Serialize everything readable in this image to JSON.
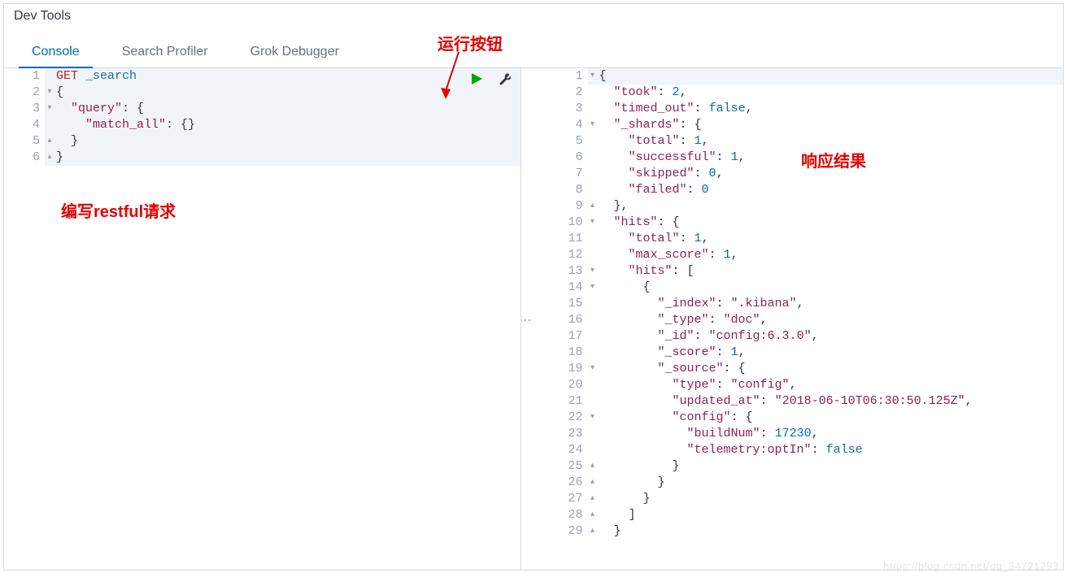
{
  "title": "Dev Tools",
  "tabs": [
    "Console",
    "Search Profiler",
    "Grok Debugger"
  ],
  "annotations": {
    "run_button": "运行按钮",
    "request": "编写restful请求",
    "response": "响应结果"
  },
  "request_editor": {
    "method": "GET",
    "endpoint": "_search",
    "lines": [
      {
        "n": 1,
        "fold": "",
        "tokens": [
          {
            "t": "method",
            "v": "GET"
          },
          {
            "t": "plain",
            "v": " "
          },
          {
            "t": "endpoint",
            "v": "_search"
          }
        ]
      },
      {
        "n": 2,
        "fold": "▾",
        "tokens": [
          {
            "t": "punct",
            "v": "{"
          }
        ]
      },
      {
        "n": 3,
        "fold": "▾",
        "tokens": [
          {
            "t": "plain",
            "v": "  "
          },
          {
            "t": "key",
            "v": "\"query\""
          },
          {
            "t": "punct",
            "v": ": {"
          }
        ]
      },
      {
        "n": 4,
        "fold": "",
        "tokens": [
          {
            "t": "plain",
            "v": "    "
          },
          {
            "t": "key",
            "v": "\"match_all\""
          },
          {
            "t": "punct",
            "v": ": {}"
          }
        ]
      },
      {
        "n": 5,
        "fold": "▴",
        "tokens": [
          {
            "t": "plain",
            "v": "  "
          },
          {
            "t": "punct",
            "v": "}"
          }
        ]
      },
      {
        "n": 6,
        "fold": "▴",
        "tokens": [
          {
            "t": "punct",
            "v": "}"
          }
        ]
      }
    ]
  },
  "response_editor": {
    "lines": [
      {
        "n": 1,
        "fold": "▾",
        "hl": true,
        "tokens": [
          {
            "t": "punct",
            "v": "{"
          }
        ]
      },
      {
        "n": 2,
        "fold": "",
        "tokens": [
          {
            "t": "plain",
            "v": "  "
          },
          {
            "t": "key",
            "v": "\"took\""
          },
          {
            "t": "punct",
            "v": ": "
          },
          {
            "t": "num",
            "v": "2"
          },
          {
            "t": "punct",
            "v": ","
          }
        ]
      },
      {
        "n": 3,
        "fold": "",
        "tokens": [
          {
            "t": "plain",
            "v": "  "
          },
          {
            "t": "key",
            "v": "\"timed_out\""
          },
          {
            "t": "punct",
            "v": ": "
          },
          {
            "t": "kw",
            "v": "false"
          },
          {
            "t": "punct",
            "v": ","
          }
        ]
      },
      {
        "n": 4,
        "fold": "▾",
        "tokens": [
          {
            "t": "plain",
            "v": "  "
          },
          {
            "t": "key",
            "v": "\"_shards\""
          },
          {
            "t": "punct",
            "v": ": {"
          }
        ]
      },
      {
        "n": 5,
        "fold": "",
        "tokens": [
          {
            "t": "plain",
            "v": "    "
          },
          {
            "t": "key",
            "v": "\"total\""
          },
          {
            "t": "punct",
            "v": ": "
          },
          {
            "t": "num",
            "v": "1"
          },
          {
            "t": "punct",
            "v": ","
          }
        ]
      },
      {
        "n": 6,
        "fold": "",
        "tokens": [
          {
            "t": "plain",
            "v": "    "
          },
          {
            "t": "key",
            "v": "\"successful\""
          },
          {
            "t": "punct",
            "v": ": "
          },
          {
            "t": "num",
            "v": "1"
          },
          {
            "t": "punct",
            "v": ","
          }
        ]
      },
      {
        "n": 7,
        "fold": "",
        "tokens": [
          {
            "t": "plain",
            "v": "    "
          },
          {
            "t": "key",
            "v": "\"skipped\""
          },
          {
            "t": "punct",
            "v": ": "
          },
          {
            "t": "num",
            "v": "0"
          },
          {
            "t": "punct",
            "v": ","
          }
        ]
      },
      {
        "n": 8,
        "fold": "",
        "tokens": [
          {
            "t": "plain",
            "v": "    "
          },
          {
            "t": "key",
            "v": "\"failed\""
          },
          {
            "t": "punct",
            "v": ": "
          },
          {
            "t": "num",
            "v": "0"
          }
        ]
      },
      {
        "n": 9,
        "fold": "▴",
        "tokens": [
          {
            "t": "plain",
            "v": "  "
          },
          {
            "t": "punct",
            "v": "},"
          }
        ]
      },
      {
        "n": 10,
        "fold": "▾",
        "tokens": [
          {
            "t": "plain",
            "v": "  "
          },
          {
            "t": "key",
            "v": "\"hits\""
          },
          {
            "t": "punct",
            "v": ": {"
          }
        ]
      },
      {
        "n": 11,
        "fold": "",
        "tokens": [
          {
            "t": "plain",
            "v": "    "
          },
          {
            "t": "key",
            "v": "\"total\""
          },
          {
            "t": "punct",
            "v": ": "
          },
          {
            "t": "num",
            "v": "1"
          },
          {
            "t": "punct",
            "v": ","
          }
        ]
      },
      {
        "n": 12,
        "fold": "",
        "tokens": [
          {
            "t": "plain",
            "v": "    "
          },
          {
            "t": "key",
            "v": "\"max_score\""
          },
          {
            "t": "punct",
            "v": ": "
          },
          {
            "t": "num",
            "v": "1"
          },
          {
            "t": "punct",
            "v": ","
          }
        ]
      },
      {
        "n": 13,
        "fold": "▾",
        "tokens": [
          {
            "t": "plain",
            "v": "    "
          },
          {
            "t": "key",
            "v": "\"hits\""
          },
          {
            "t": "punct",
            "v": ": ["
          }
        ]
      },
      {
        "n": 14,
        "fold": "▾",
        "tokens": [
          {
            "t": "plain",
            "v": "      "
          },
          {
            "t": "punct",
            "v": "{"
          }
        ]
      },
      {
        "n": 15,
        "fold": "",
        "tokens": [
          {
            "t": "plain",
            "v": "        "
          },
          {
            "t": "key",
            "v": "\"_index\""
          },
          {
            "t": "punct",
            "v": ": "
          },
          {
            "t": "str",
            "v": "\".kibana\""
          },
          {
            "t": "punct",
            "v": ","
          }
        ]
      },
      {
        "n": 16,
        "fold": "",
        "tokens": [
          {
            "t": "plain",
            "v": "        "
          },
          {
            "t": "key",
            "v": "\"_type\""
          },
          {
            "t": "punct",
            "v": ": "
          },
          {
            "t": "str",
            "v": "\"doc\""
          },
          {
            "t": "punct",
            "v": ","
          }
        ]
      },
      {
        "n": 17,
        "fold": "",
        "tokens": [
          {
            "t": "plain",
            "v": "        "
          },
          {
            "t": "key",
            "v": "\"_id\""
          },
          {
            "t": "punct",
            "v": ": "
          },
          {
            "t": "str",
            "v": "\"config:6.3.0\""
          },
          {
            "t": "punct",
            "v": ","
          }
        ]
      },
      {
        "n": 18,
        "fold": "",
        "tokens": [
          {
            "t": "plain",
            "v": "        "
          },
          {
            "t": "key",
            "v": "\"_score\""
          },
          {
            "t": "punct",
            "v": ": "
          },
          {
            "t": "num",
            "v": "1"
          },
          {
            "t": "punct",
            "v": ","
          }
        ]
      },
      {
        "n": 19,
        "fold": "▾",
        "tokens": [
          {
            "t": "plain",
            "v": "        "
          },
          {
            "t": "key",
            "v": "\"_source\""
          },
          {
            "t": "punct",
            "v": ": {"
          }
        ]
      },
      {
        "n": 20,
        "fold": "",
        "tokens": [
          {
            "t": "plain",
            "v": "          "
          },
          {
            "t": "key",
            "v": "\"type\""
          },
          {
            "t": "punct",
            "v": ": "
          },
          {
            "t": "str",
            "v": "\"config\""
          },
          {
            "t": "punct",
            "v": ","
          }
        ]
      },
      {
        "n": 21,
        "fold": "",
        "tokens": [
          {
            "t": "plain",
            "v": "          "
          },
          {
            "t": "key",
            "v": "\"updated_at\""
          },
          {
            "t": "punct",
            "v": ": "
          },
          {
            "t": "str",
            "v": "\"2018-06-10T06:30:50.125Z\""
          },
          {
            "t": "punct",
            "v": ","
          }
        ]
      },
      {
        "n": 22,
        "fold": "▾",
        "tokens": [
          {
            "t": "plain",
            "v": "          "
          },
          {
            "t": "key",
            "v": "\"config\""
          },
          {
            "t": "punct",
            "v": ": {"
          }
        ]
      },
      {
        "n": 23,
        "fold": "",
        "tokens": [
          {
            "t": "plain",
            "v": "            "
          },
          {
            "t": "key",
            "v": "\"buildNum\""
          },
          {
            "t": "punct",
            "v": ": "
          },
          {
            "t": "num",
            "v": "17230"
          },
          {
            "t": "punct",
            "v": ","
          }
        ]
      },
      {
        "n": 24,
        "fold": "",
        "tokens": [
          {
            "t": "plain",
            "v": "            "
          },
          {
            "t": "key",
            "v": "\"telemetry:optIn\""
          },
          {
            "t": "punct",
            "v": ": "
          },
          {
            "t": "kw",
            "v": "false"
          }
        ]
      },
      {
        "n": 25,
        "fold": "▴",
        "tokens": [
          {
            "t": "plain",
            "v": "          "
          },
          {
            "t": "punct",
            "v": "}"
          }
        ]
      },
      {
        "n": 26,
        "fold": "▴",
        "tokens": [
          {
            "t": "plain",
            "v": "        "
          },
          {
            "t": "punct",
            "v": "}"
          }
        ]
      },
      {
        "n": 27,
        "fold": "▴",
        "tokens": [
          {
            "t": "plain",
            "v": "      "
          },
          {
            "t": "punct",
            "v": "}"
          }
        ]
      },
      {
        "n": 28,
        "fold": "▴",
        "tokens": [
          {
            "t": "plain",
            "v": "    "
          },
          {
            "t": "punct",
            "v": "]"
          }
        ]
      },
      {
        "n": 29,
        "fold": "▴",
        "tokens": [
          {
            "t": "plain",
            "v": "  "
          },
          {
            "t": "punct",
            "v": "}"
          }
        ]
      }
    ]
  },
  "watermark": "https://blog.csdn.net/qq_34721293"
}
